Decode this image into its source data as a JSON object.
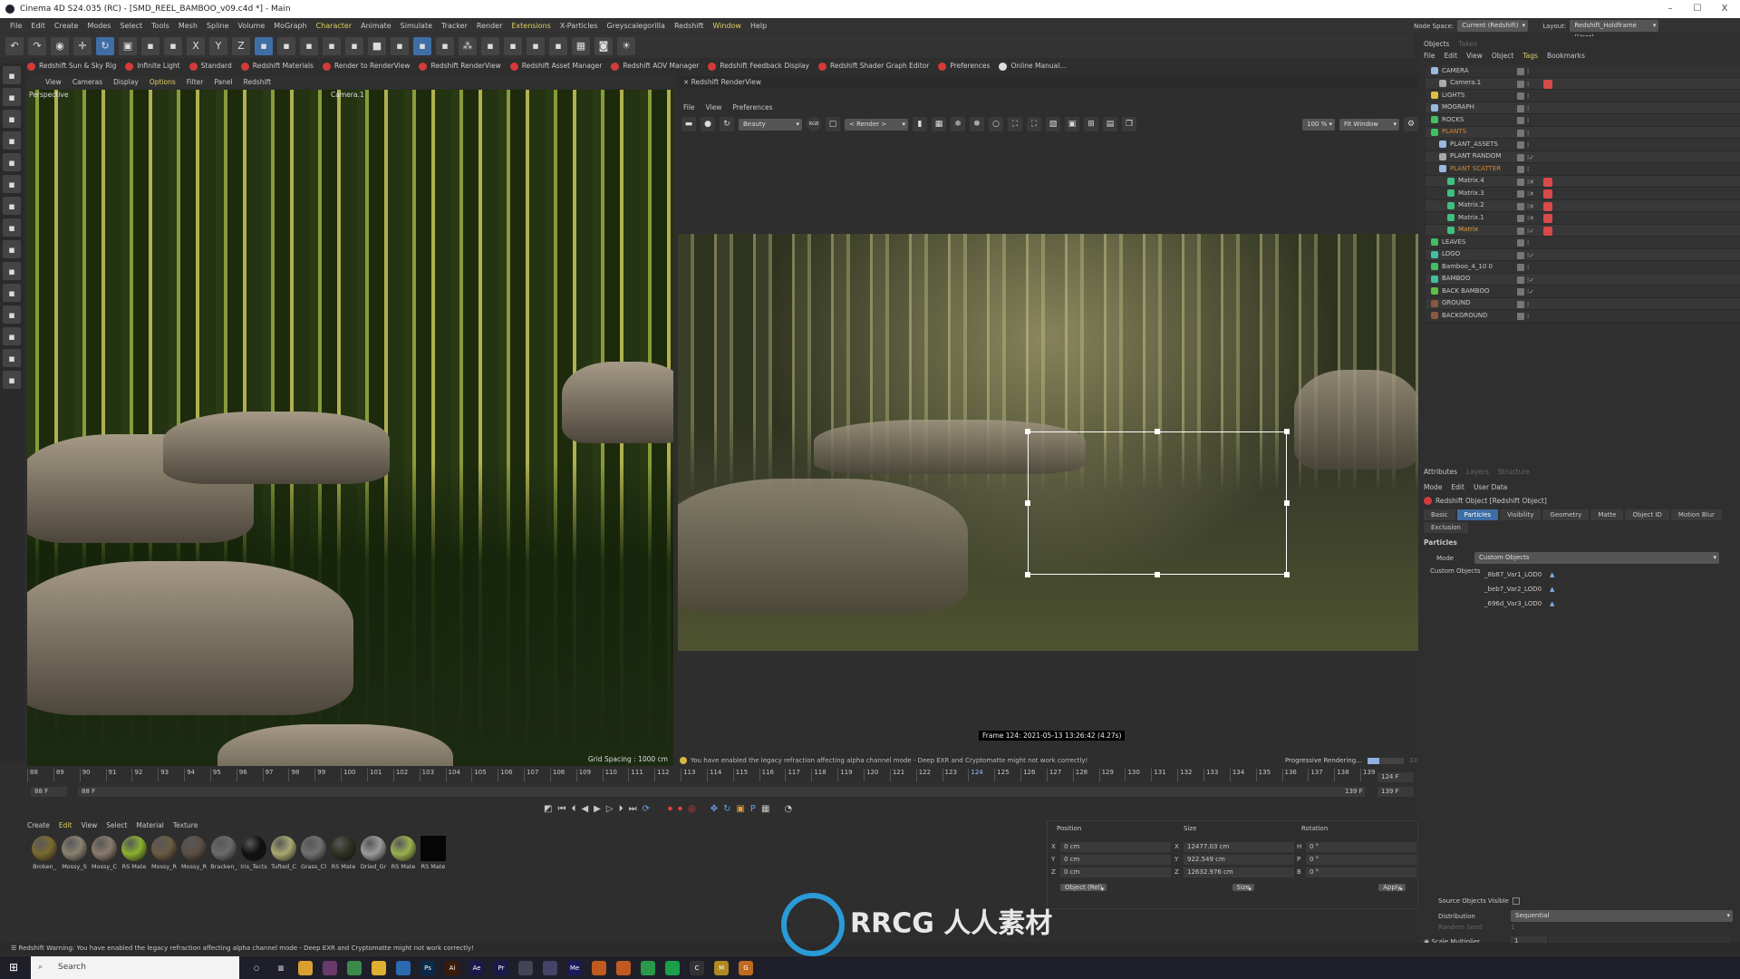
{
  "window": {
    "title": "Cinema 4D S24.035 (RC) - [SMD_REEL_BAMBOO_v09.c4d *] - Main",
    "min": "–",
    "max": "☐",
    "close": "X"
  },
  "menu": [
    "File",
    "Edit",
    "Create",
    "Modes",
    "Select",
    "Tools",
    "Mesh",
    "Spline",
    "Volume",
    "MoGraph",
    "Character",
    "Animate",
    "Simulate",
    "Tracker",
    "Render",
    "Extensions",
    "X-Particles",
    "Greyscalegorilla",
    "Redshift",
    "Window",
    "Help"
  ],
  "node_space": {
    "label": "Node Space:",
    "value": "Current (Redshift)"
  },
  "layout": {
    "label": "Layout:",
    "value": "Redshift_Holdframe (User)"
  },
  "shelf": [
    "Redshift Sun & Sky Rig",
    "Infinite Light",
    "Standard",
    "Redshift Materials",
    "Render to RenderView",
    "Redshift RenderView",
    "Redshift Asset Manager",
    "Redshift AOV Manager",
    "Redshift Feedback Display",
    "Redshift Shader Graph Editor",
    "Preferences",
    "Online Manual..."
  ],
  "viewport": {
    "menu": [
      "View",
      "Cameras",
      "Display",
      "Options",
      "Filter",
      "Panel",
      "Redshift"
    ],
    "projection": "Perspective",
    "camera": "Camera.1",
    "grid": "Grid Spacing : 1000 cm"
  },
  "renderview": {
    "title": "Redshift RenderView",
    "menu": [
      "File",
      "View",
      "Preferences"
    ],
    "aov": "Beauty",
    "rgb": "RGB",
    "render_sel": "< Render >",
    "zoom": "100 %",
    "fit": "Fit Window",
    "frame_info": "Frame 124: 2021-05-13 13:26:42 (4.27s)",
    "warning": "You have enabled the legacy refraction affecting alpha channel mode - Deep EXR and Cryptomatte might not work correctly!",
    "progress_label": "Progressive Rendering...",
    "progress": 0.33,
    "progress_text": "33%"
  },
  "timeline": {
    "frames": [
      "88",
      "89",
      "90",
      "91",
      "92",
      "93",
      "94",
      "95",
      "96",
      "97",
      "98",
      "99",
      "100",
      "101",
      "102",
      "103",
      "104",
      "105",
      "106",
      "107",
      "108",
      "109",
      "110",
      "111",
      "112",
      "113",
      "114",
      "115",
      "116",
      "117",
      "118",
      "119",
      "120",
      "121",
      "122",
      "123",
      "124",
      "125",
      "126",
      "127",
      "128",
      "129",
      "130",
      "131",
      "132",
      "133",
      "134",
      "135",
      "136",
      "137",
      "138",
      "139"
    ],
    "current": "124",
    "current_field": "124 F",
    "start": "88 F",
    "start2": "88 F",
    "end": "139 F",
    "end2": "139 F"
  },
  "materials": {
    "menu": [
      "Create",
      "Edit",
      "View",
      "Select",
      "Material",
      "Texture"
    ],
    "items": [
      {
        "name": "Broken_",
        "color": "#7a6a30"
      },
      {
        "name": "Mossy_S",
        "color": "#8a8270"
      },
      {
        "name": "Mossy_C",
        "color": "#8a7a6c"
      },
      {
        "name": "RS Mate",
        "color": "#8ab030"
      },
      {
        "name": "Mossy_R",
        "color": "#6c5a44"
      },
      {
        "name": "Mossy_R",
        "color": "#5a4e44"
      },
      {
        "name": "Bracken_",
        "color": "#6a6a6a"
      },
      {
        "name": "Iris_Tects",
        "color": "#111111"
      },
      {
        "name": "Tufted_C",
        "color": "#a8a870"
      },
      {
        "name": "Grass_Cl",
        "color": "#707070"
      },
      {
        "name": "RS Mate",
        "color": "#2e3020"
      },
      {
        "name": "Dried_Gr",
        "color": "#9a9a9a"
      },
      {
        "name": "RS Mate",
        "color": "#9ab050"
      },
      {
        "name": "RS Mate",
        "color": "#050505"
      }
    ]
  },
  "coords": {
    "position": "Position",
    "size": "Size",
    "rotation": "Rotation",
    "px": "0 cm",
    "py": "0 cm",
    "pz": "0 cm",
    "sx": "12477.03 cm",
    "sy": "922.549 cm",
    "sz": "12632.976 cm",
    "rh": "0 °",
    "rp": "0 °",
    "rb": "0 °",
    "mode": "Object (Rel)",
    "size_mode": "Size",
    "apply": "Apply"
  },
  "objects": {
    "tabs": [
      "Objects",
      "Takes"
    ],
    "menu": [
      "File",
      "Edit",
      "View",
      "Object",
      "Tags",
      "Bookmarks"
    ],
    "items": [
      {
        "name": "CAMERA",
        "depth": 0,
        "color": "#9ab8e0",
        "tag": false
      },
      {
        "name": "Camera.1",
        "depth": 1,
        "color": "#aaaaaa",
        "tag": true
      },
      {
        "name": "LIGHTS",
        "depth": 0,
        "color": "#e0c040",
        "tag": false
      },
      {
        "name": "MOGRAPH",
        "depth": 0,
        "color": "#9ab8e0",
        "tag": false
      },
      {
        "name": "ROCKS",
        "depth": 0,
        "color": "#40c060",
        "tag": false
      },
      {
        "name": "PLANTS",
        "depth": 0,
        "color": "#40c060",
        "tag": false,
        "hl": "#d08a3a"
      },
      {
        "name": "PLANT_ASSETS",
        "depth": 1,
        "color": "#9ab8e0",
        "tag": false
      },
      {
        "name": "PLANT RANDOM",
        "depth": 1,
        "color": "#aaaaaa",
        "tag": false,
        "check": true
      },
      {
        "name": "PLANT SCATTER",
        "depth": 1,
        "color": "#9ab8e0",
        "tag": false,
        "hl": "#d08a3a"
      },
      {
        "name": "Matrix.4",
        "depth": 2,
        "color": "#40c080",
        "tag": true
      },
      {
        "name": "Matrix.3",
        "depth": 2,
        "color": "#40c080",
        "tag": true
      },
      {
        "name": "Matrix.2",
        "depth": 2,
        "color": "#40c080",
        "tag": true
      },
      {
        "name": "Matrix.1",
        "depth": 2,
        "color": "#40c080",
        "tag": true
      },
      {
        "name": "Matrix",
        "depth": 2,
        "color": "#40c080",
        "tag": true,
        "hl": "#e0a040",
        "check": true
      },
      {
        "name": "LEAVES",
        "depth": 0,
        "color": "#40c060",
        "tag": false
      },
      {
        "name": "LOGO",
        "depth": 0,
        "color": "#40c0a0",
        "tag": false,
        "check": true
      },
      {
        "name": "Bamboo_4_10 0",
        "depth": 0,
        "color": "#40c060",
        "tag": false
      },
      {
        "name": "BAMBOO",
        "depth": 0,
        "color": "#40c0a0",
        "tag": false,
        "check": true
      },
      {
        "name": "BACK BAMBOO",
        "depth": 0,
        "color": "#60c040",
        "tag": false,
        "check": true
      },
      {
        "name": "GROUND",
        "depth": 0,
        "color": "#8a5a40",
        "tag": false
      },
      {
        "name": "BACKGROUND",
        "depth": 0,
        "color": "#8a5a40",
        "tag": false
      }
    ]
  },
  "attributes": {
    "tabs": [
      "Attributes",
      "Layers",
      "Structure"
    ],
    "menu": [
      "Mode",
      "Edit",
      "User Data"
    ],
    "object": "Redshift Object [Redshift Object]",
    "sections": [
      "Basic",
      "Particles",
      "Visibility",
      "Geometry",
      "Matte",
      "Object ID",
      "Motion Blur",
      "Exclusion"
    ],
    "active_section": "Particles",
    "group": "Particles",
    "mode_label": "Mode",
    "mode_value": "Custom Objects",
    "custom_label": "Custom Objects",
    "custom_items": [
      "_8b87_Var1_LOD0",
      "_beb7_Var2_LOD0",
      "_696d_Var3_LOD0"
    ],
    "source_visible": "Source Objects Visible",
    "distribution_label": "Distribution",
    "distribution": "Sequential",
    "seed_label": "Random Seed",
    "seed": "1",
    "scale_label": "Scale Multiplier",
    "scale": "1"
  },
  "status": "Redshift Warning: You have enabled the legacy refraction affecting alpha channel mode - Deep EXR and Cryptomatte might not work correctly!",
  "taskbar": {
    "search": "Search",
    "apps": [
      {
        "n": "chrome",
        "c": "#d9a030"
      },
      {
        "n": "slack",
        "c": "#6a3a6a"
      },
      {
        "n": "chrome-dev",
        "c": "#3a8a4a"
      },
      {
        "n": "explorer",
        "c": "#e0b030"
      },
      {
        "n": "mail",
        "c": "#2a6ab0"
      },
      {
        "n": "Ps",
        "c": "#0a2a4a"
      },
      {
        "n": "Ai",
        "c": "#3a1a0a"
      },
      {
        "n": "Ae",
        "c": "#1a1a4a"
      },
      {
        "n": "Pr",
        "c": "#1a1a4a"
      },
      {
        "n": "cinema4d",
        "c": "#445"
      },
      {
        "n": "cinema4d-2",
        "c": "#446"
      },
      {
        "n": "Me",
        "c": "#1a1a5a"
      },
      {
        "n": "houdini",
        "c": "#c05a20"
      },
      {
        "n": "houdini-2",
        "c": "#c05a20"
      },
      {
        "n": "whatsapp",
        "c": "#2a9a4a"
      },
      {
        "n": "spotify",
        "c": "#1aa04a"
      },
      {
        "n": "C",
        "c": "#333"
      },
      {
        "n": "M",
        "c": "#b08a20"
      },
      {
        "n": "G",
        "c": "#c06a20"
      }
    ]
  },
  "watermark": "RRCG 人人素材"
}
